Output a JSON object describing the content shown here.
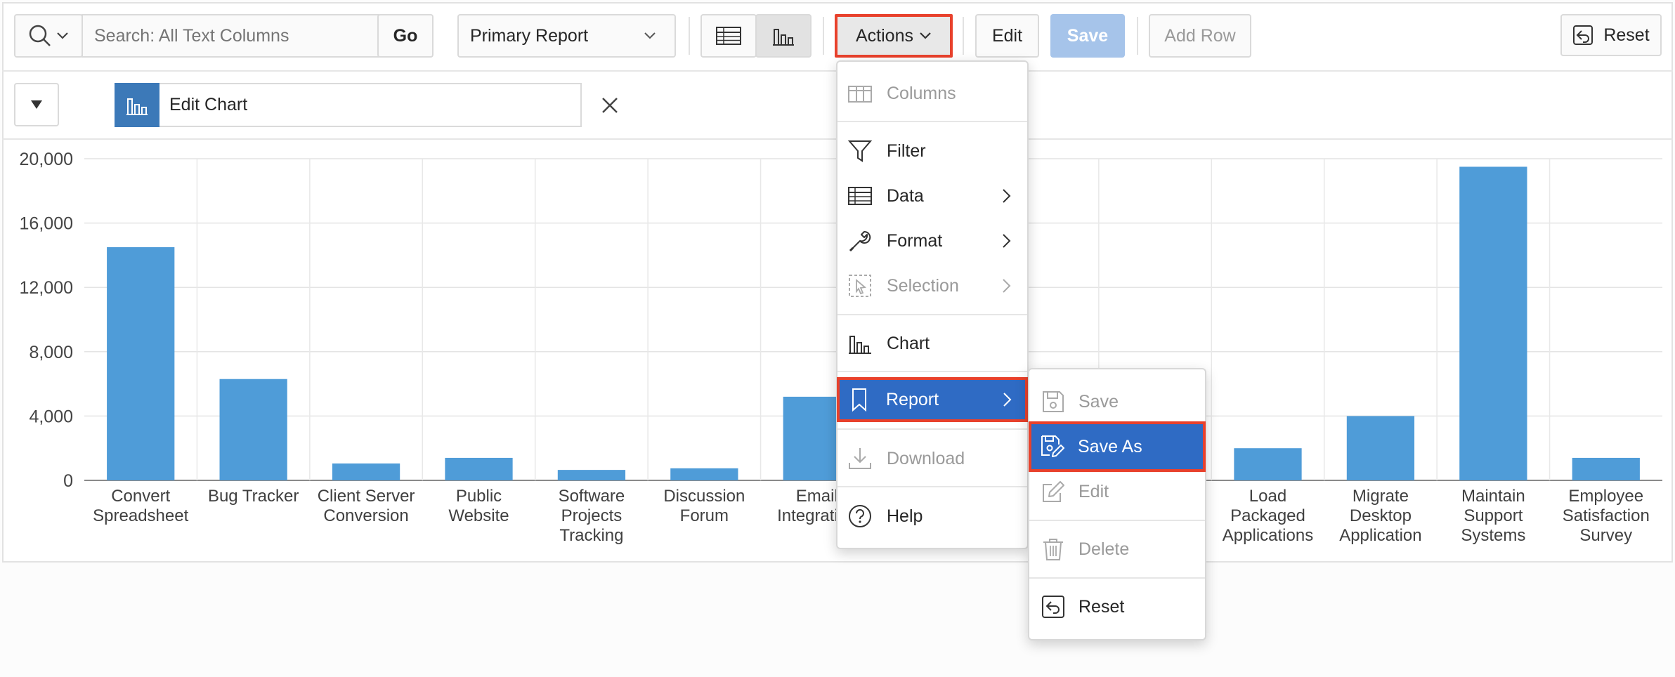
{
  "toolbar": {
    "search_placeholder": "Search: All Text Columns",
    "go_label": "Go",
    "report_select": "Primary Report",
    "actions_label": "Actions",
    "edit_label": "Edit",
    "save_label": "Save",
    "add_row_label": "Add Row",
    "reset_label": "Reset"
  },
  "control_panel": {
    "edit_chart_label": "Edit Chart"
  },
  "actions_menu": {
    "items": [
      "Columns",
      "Filter",
      "Data",
      "Format",
      "Selection",
      "Chart",
      "Report",
      "Download",
      "Help"
    ]
  },
  "report_submenu": {
    "items": [
      "Save",
      "Save As",
      "Edit",
      "Delete",
      "Reset"
    ]
  },
  "colors": {
    "bar": "#4f9cd8",
    "menu_highlight": "#2f6bc4",
    "focus_outline": "#e8412c",
    "save_button": "#a6c4ea"
  },
  "chart_data": {
    "type": "bar",
    "ylim": [
      0,
      20000
    ],
    "yticks": [
      "20,000",
      "16,000",
      "12,000",
      "8,000",
      "4,000",
      "0"
    ],
    "categories": [
      [
        "Convert",
        "Spreadsheet"
      ],
      [
        "Bug Tracker"
      ],
      [
        "Client Server",
        "Conversion"
      ],
      [
        "Public",
        "Website"
      ],
      [
        "Software",
        "Projects",
        "Tracking"
      ],
      [
        "Discussion",
        "Forum"
      ],
      [
        "Email",
        "Integration"
      ],
      [
        ""
      ],
      [
        ""
      ],
      [
        ""
      ],
      [
        "Load",
        "Packaged",
        "Applications"
      ],
      [
        "Migrate",
        "Desktop",
        "Application"
      ],
      [
        "Maintain",
        "Support",
        "Systems"
      ],
      [
        "Employee",
        "Satisfaction",
        "Survey"
      ]
    ],
    "values": [
      14500,
      6300,
      1050,
      1400,
      650,
      750,
      5200,
      0,
      0,
      0,
      2000,
      4000,
      19500,
      1400
    ]
  }
}
